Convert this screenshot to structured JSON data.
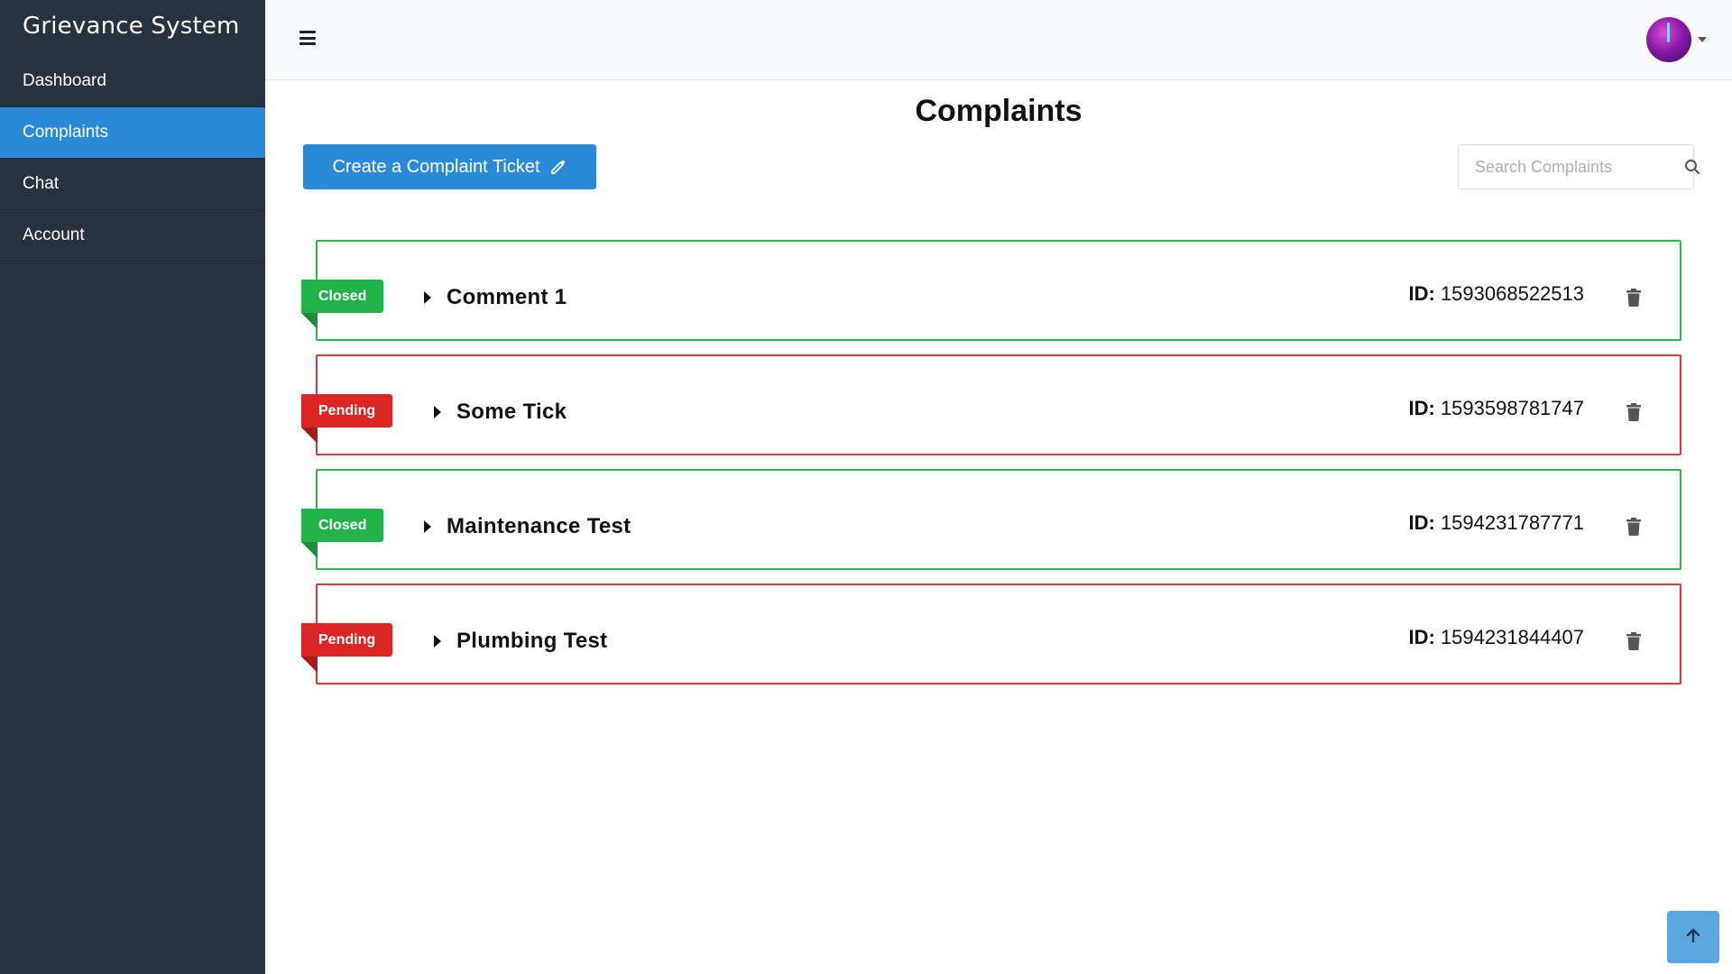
{
  "app": {
    "title": "Grievance System"
  },
  "sidebar": {
    "items": [
      {
        "label": "Dashboard",
        "active": false
      },
      {
        "label": "Complaints",
        "active": true
      },
      {
        "label": "Chat",
        "active": false
      },
      {
        "label": "Account",
        "active": false
      }
    ]
  },
  "topbar": {
    "menu_icon": "hamburger-icon",
    "avatar": "user-avatar"
  },
  "page": {
    "title": "Complaints"
  },
  "actions": {
    "create_label": "Create a Complaint Ticket",
    "create_icon": "pencil-icon",
    "search_placeholder": "Search Complaints",
    "search_icon": "search-icon"
  },
  "colors": {
    "accent": "#2b8ad8",
    "sidebar": "#26333f",
    "closed": "#21b34a",
    "pending": "#dc2626"
  },
  "complaints": [
    {
      "status": "Closed",
      "title": "Comment 1",
      "id_label": "ID:",
      "id": "1593068522513"
    },
    {
      "status": "Pending",
      "title": "Some Tick",
      "id_label": "ID:",
      "id": "1593598781747"
    },
    {
      "status": "Closed",
      "title": "Maintenance Test",
      "id_label": "ID:",
      "id": "1594231787771"
    },
    {
      "status": "Pending",
      "title": "Plumbing Test",
      "id_label": "ID:",
      "id": "1594231844407"
    }
  ]
}
